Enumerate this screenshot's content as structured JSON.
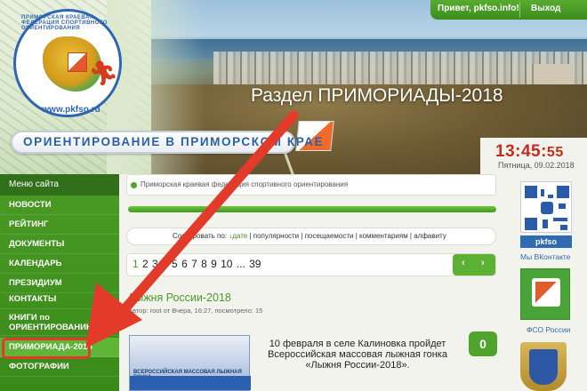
{
  "header": {
    "logo_url_text": "www.pkfso.ru",
    "logo_arc_text": "ПРИМОРСКАЯ КРАЕВАЯ ФЕДЕРАЦИЯ СПОРТИВНОГО ОРИЕНТИРОВАНИЯ",
    "site_title": "ОРИЕНТИРОВАНИЕ В ПРИМОРСКОМ КРАЕ",
    "headline": "Раздел ПРИМОРИАДЫ-2018",
    "greeting": "Привет, pkfso.info!",
    "logout": "Выход",
    "clock_hm": "13:45:",
    "clock_s": "55",
    "date": "Пятница, 09.02.2018"
  },
  "sidebar": {
    "title": "Меню сайта",
    "items": [
      {
        "label": "НОВОСТИ"
      },
      {
        "label": "РЕЙТИНГ"
      },
      {
        "label": "ДОКУМЕНТЫ"
      },
      {
        "label": "КАЛЕНДАРЬ"
      },
      {
        "label": "ПРЕЗИДИУМ"
      },
      {
        "label": "КОНТАКТЫ"
      },
      {
        "label": "КНИГИ по ОРИЕНТИРОВАНИЮ"
      },
      {
        "label": "ПРИМОРИАДА-2018"
      },
      {
        "label": "ФОТОГРАФИИ"
      }
    ]
  },
  "main": {
    "breadcrumb": "Приморская краевая федерация спортивного ориентирования",
    "sort": {
      "label": "Сортировать по:",
      "options": [
        "дате",
        "популярности",
        "посещаемости",
        "комментариям",
        "алфавиту"
      ]
    },
    "pager": {
      "current": "1",
      "pages": "2 3 4 5 6 7 8 9 10 ... 39"
    },
    "article": {
      "title": "Лыжня России-2018",
      "meta": "Автор: root от Вчера, 16:27, посмотрело: 15",
      "image_caption": "ВСЕРОССИЙСКАЯ МАССОВАЯ ЛЫЖНАЯ ГОНКА",
      "text": "10 февраля в селе Калиновка пройдет Всероссийская массовая лыжная гонка «Лыжня России-2018».",
      "comments": "0"
    }
  },
  "right": {
    "qr_label": "pkfso",
    "vk_text": "Мы ВКонтакте",
    "fso_text": "ФСО России"
  },
  "colors": {
    "brand_green": "#4a9a25",
    "accent_red": "#e33a2a",
    "clock_red": "#c92a1e",
    "link_blue": "#2f6ab3"
  }
}
